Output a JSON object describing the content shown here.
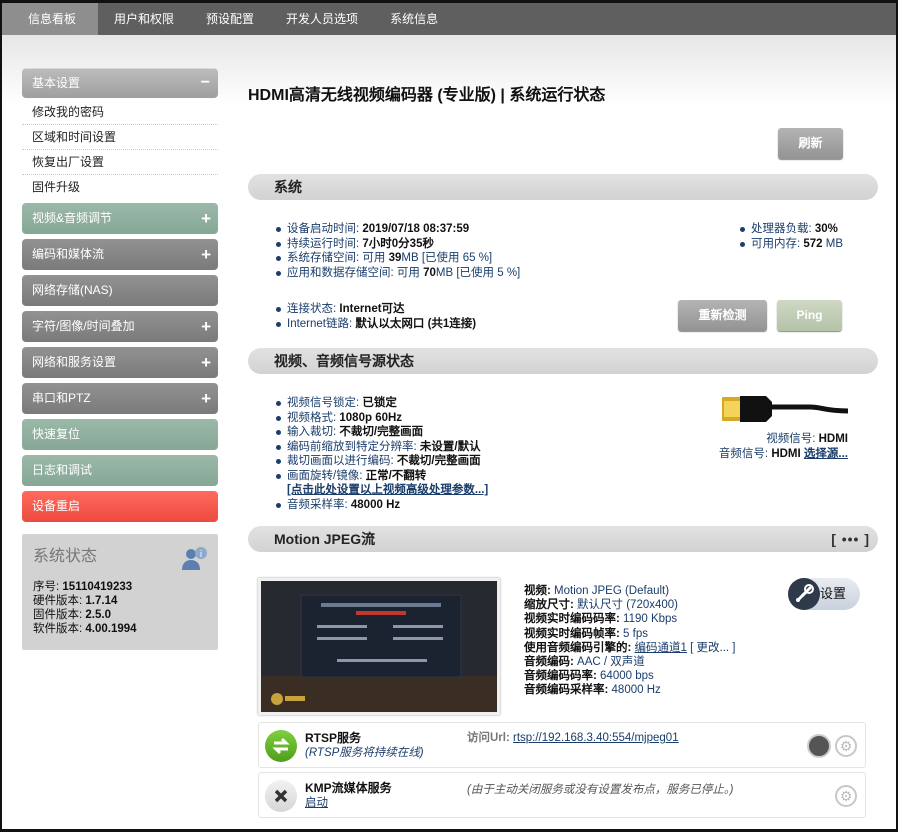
{
  "topnav": [
    "信息看板",
    "用户和权限",
    "预设配置",
    "开发人员选项",
    "系统信息"
  ],
  "sidebar": {
    "basic": {
      "label": "基本设置",
      "sym": "−",
      "items": [
        "修改我的密码",
        "区域和时间设置",
        "恢复出厂设置",
        "固件升级"
      ]
    },
    "sections": [
      {
        "label": "视频&音频调节",
        "sym": "+"
      },
      {
        "label": "编码和媒体流",
        "sym": "+"
      },
      {
        "label": "网络存储(NAS)",
        "sym": ""
      },
      {
        "label": "字符/图像/时间叠加",
        "sym": "+"
      },
      {
        "label": "网络和服务设置",
        "sym": "+"
      },
      {
        "label": "串口和PTZ",
        "sym": "+"
      },
      {
        "label": "快速复位",
        "sym": ""
      },
      {
        "label": "日志和调试",
        "sym": ""
      },
      {
        "label": "设备重启",
        "sym": ""
      }
    ],
    "status": {
      "title": "系统状态",
      "serial_label": "序号:",
      "serial": "15110419233",
      "hw_label": "硬件版本:",
      "hw": "1.7.14",
      "fw_label": "固件版本:",
      "fw": "2.5.0",
      "sw_label": "软件版本:",
      "sw": "4.00.1994"
    }
  },
  "page_title": "HDMI高清无线视频编码器 (专业版) | 系统运行状态",
  "refresh_label": "刷新",
  "system": {
    "header": "系统",
    "left": [
      {
        "label": "设备启动时间: ",
        "value": "2019/07/18 08:37:59"
      },
      {
        "label": "持续运行时间: ",
        "value": "7小时0分35秒"
      },
      {
        "label": "系统存储空间: 可用 ",
        "value": "39",
        "suffix": "MB [已使用 65 %]"
      },
      {
        "label": "应用和数据存储空间: 可用 ",
        "value": "70",
        "suffix": "MB [已使用 5 %]"
      }
    ],
    "right": [
      {
        "label": "处理器负载: ",
        "value": "30%"
      },
      {
        "label": "可用内存: ",
        "value": "572",
        "suffix": " MB"
      }
    ],
    "conn": [
      {
        "label": "连接状态: ",
        "value": "Internet可达"
      },
      {
        "label": "Internet链路: ",
        "value": "默认以太网口 (共1连接)"
      }
    ],
    "recheck_label": "重新检测",
    "ping_label": "Ping"
  },
  "video": {
    "header": "视频、音频信号源状态",
    "items": [
      {
        "label": "视频信号锁定: ",
        "value": "已锁定"
      },
      {
        "label": "视频格式: ",
        "value": "1080p 60Hz"
      },
      {
        "label": "输入裁切: ",
        "value": "不裁切/完整画面"
      },
      {
        "label": "编码前缩放到特定分辨率: ",
        "value": "未设置/默认"
      },
      {
        "label": "裁切画面以进行编码: ",
        "value": "不裁切/完整画面"
      },
      {
        "label": "画面旋转/镜像: ",
        "value": "正常/不翻转"
      }
    ],
    "adv_link": "[点击此处设置以上视频高级处理参数...]",
    "audio_rate_label": "音频采样率: ",
    "audio_rate": "48000 Hz",
    "sig_video_label": "视频信号: ",
    "sig_video": "HDMI",
    "sig_audio_label": "音频信号: ",
    "sig_audio": "HDMI",
    "choose_src": "选择源..."
  },
  "mjpeg": {
    "header": "Motion JPEG流",
    "menu": "[ ••• ]",
    "info": [
      {
        "label": "视频: ",
        "value": "Motion JPEG (Default)"
      },
      {
        "label": "缩放尺寸: ",
        "value": "默认尺寸 (720x400)"
      },
      {
        "label": "视频实时编码码率: ",
        "value": "1190 Kbps"
      },
      {
        "label": "视频实时编码帧率: ",
        "value": "5 fps"
      },
      {
        "label": "使用音频编码引擎的: ",
        "value": "编码通道1",
        "extra": " [ 更改... ]"
      },
      {
        "label": "音频编码: ",
        "value": "AAC / 双声道"
      },
      {
        "label": "音频编码码率: ",
        "value": "64000 bps"
      },
      {
        "label": "音频编码采样率: ",
        "value": "48000 Hz"
      }
    ],
    "settings_label": "设置",
    "rtsp": {
      "name": "RTSP服务",
      "sub": "(RTSP服务将持续在线)",
      "url_label": "访问Url: ",
      "url": "rtsp://192.168.3.40:554/mjpeg01"
    },
    "kmp": {
      "name": "KMP流媒体服务",
      "sub": "启动",
      "note": "(由于主动关闭服务或没有设置发布点，服务已停止。)"
    }
  },
  "colors": {
    "accent_red": "#ee4a40",
    "sidebar_green": "#8fae9d",
    "link": "#1a3d6b"
  }
}
